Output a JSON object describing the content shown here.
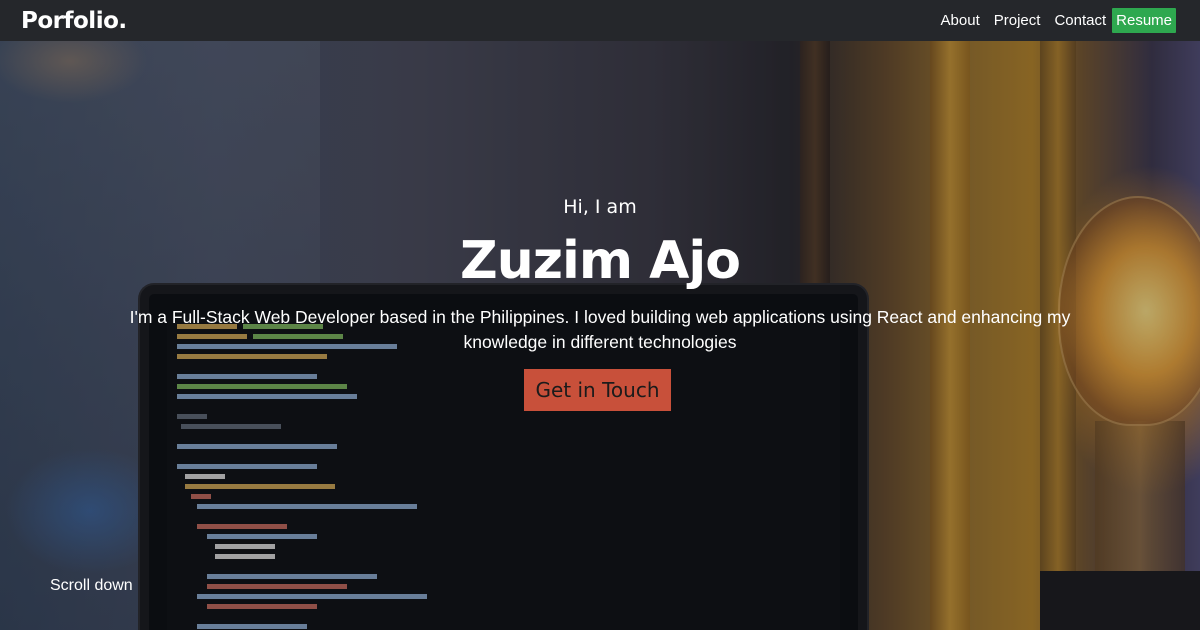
{
  "navbar": {
    "brand": "Porfolio.",
    "links": [
      "About",
      "Project",
      "Contact",
      "Resume"
    ]
  },
  "hero": {
    "greeting": "Hi, I am",
    "name": "Zuzim Ajo",
    "tagline": "I'm a Full-Stack Web Developer based in the Philippines. I loved building web applications using React and enhancing my knowledge in different technologies",
    "cta_label": "Get in Touch",
    "scroll_label": "Scroll down"
  },
  "colors": {
    "navbar_bg": "#25272b",
    "resume_button": "#2ea84f",
    "cta_button": "#c8503a",
    "text": "#ffffff"
  },
  "background_image": "laptop-with-code-and-lamp"
}
